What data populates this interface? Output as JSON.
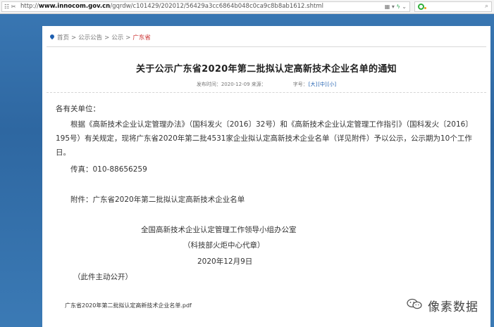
{
  "browser": {
    "url_prefix": "http://",
    "url_host": "www.innocom.gov.cn",
    "url_path": "/gqrdw/c101429/202012/56429a3cc6864b048c0ca9c8b8ab1612.shtml"
  },
  "breadcrumb": {
    "home": "首页",
    "notices": "公示公告",
    "publicity": "公示",
    "current": "广东省"
  },
  "article": {
    "title": "关于公示广东省2020年第二批拟认定高新技术企业名单的通知",
    "meta_published": "发布时间：2020-12-09 来源：",
    "meta_fontsize_label": "字号：",
    "font_large": "大",
    "font_medium": "中",
    "font_small": "小",
    "greeting": "各有关单位：",
    "paragraph": "根据《高新技术企业认定管理办法》（国科发火〔2016〕32号）和《高新技术企业认定管理工作指引》（国科发火〔2016〕195号）有关规定，现将广东省2020年第二批4531家企业拟认定高新技术企业名单（详见附件）予以公示，公示期为10个工作日。",
    "fax": "传真：010-88656259",
    "attachment": "附件：广东省2020年第二批拟认定高新技术企业名单",
    "signature_org": "全国高新技术企业认定管理工作领导小组办公室",
    "signature_sub": "（科技部火炬中心代章）",
    "signature_date": "2020年12月9日",
    "public_note": "（此件主动公开）",
    "pdf_name": "广东省2020年第二批拟认定高新技术企业名单.pdf"
  },
  "watermark": {
    "text": "像素数据",
    "icon": "wechat-icon"
  },
  "colors": {
    "background": "#3473b0",
    "link": "#1e5fb0",
    "current_crumb": "#cc3333"
  }
}
